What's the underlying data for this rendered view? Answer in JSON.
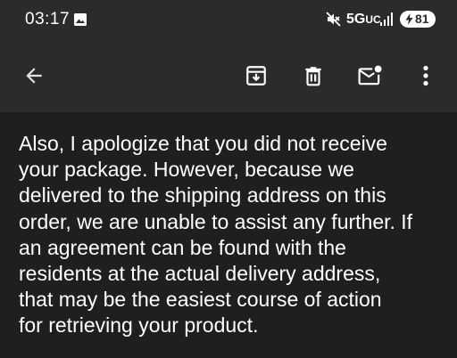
{
  "status_bar": {
    "time": "03:17",
    "network": "5G",
    "network_suffix": "UC",
    "battery": "81",
    "icons": [
      "gallery-icon",
      "mute-icon",
      "signal-icon",
      "battery-icon",
      "bolt-icon"
    ]
  },
  "toolbar": {
    "icons": [
      "back-arrow-icon",
      "archive-icon",
      "delete-icon",
      "mark-unread-icon",
      "more-vert-icon"
    ]
  },
  "message": {
    "body": "Also, I apologize that you did not receive\nyour package. However, because we\ndelivered to the shipping address on this\norder, we are unable to assist any further. If\nan agreement can be found with the\nresidents at the actual delivery address,\nthat may be the easiest course of action\nfor retrieving your product."
  },
  "colors": {
    "bar_background": "#2b2b2b",
    "content_background": "#1f1f1f",
    "text": "#ffffff"
  }
}
